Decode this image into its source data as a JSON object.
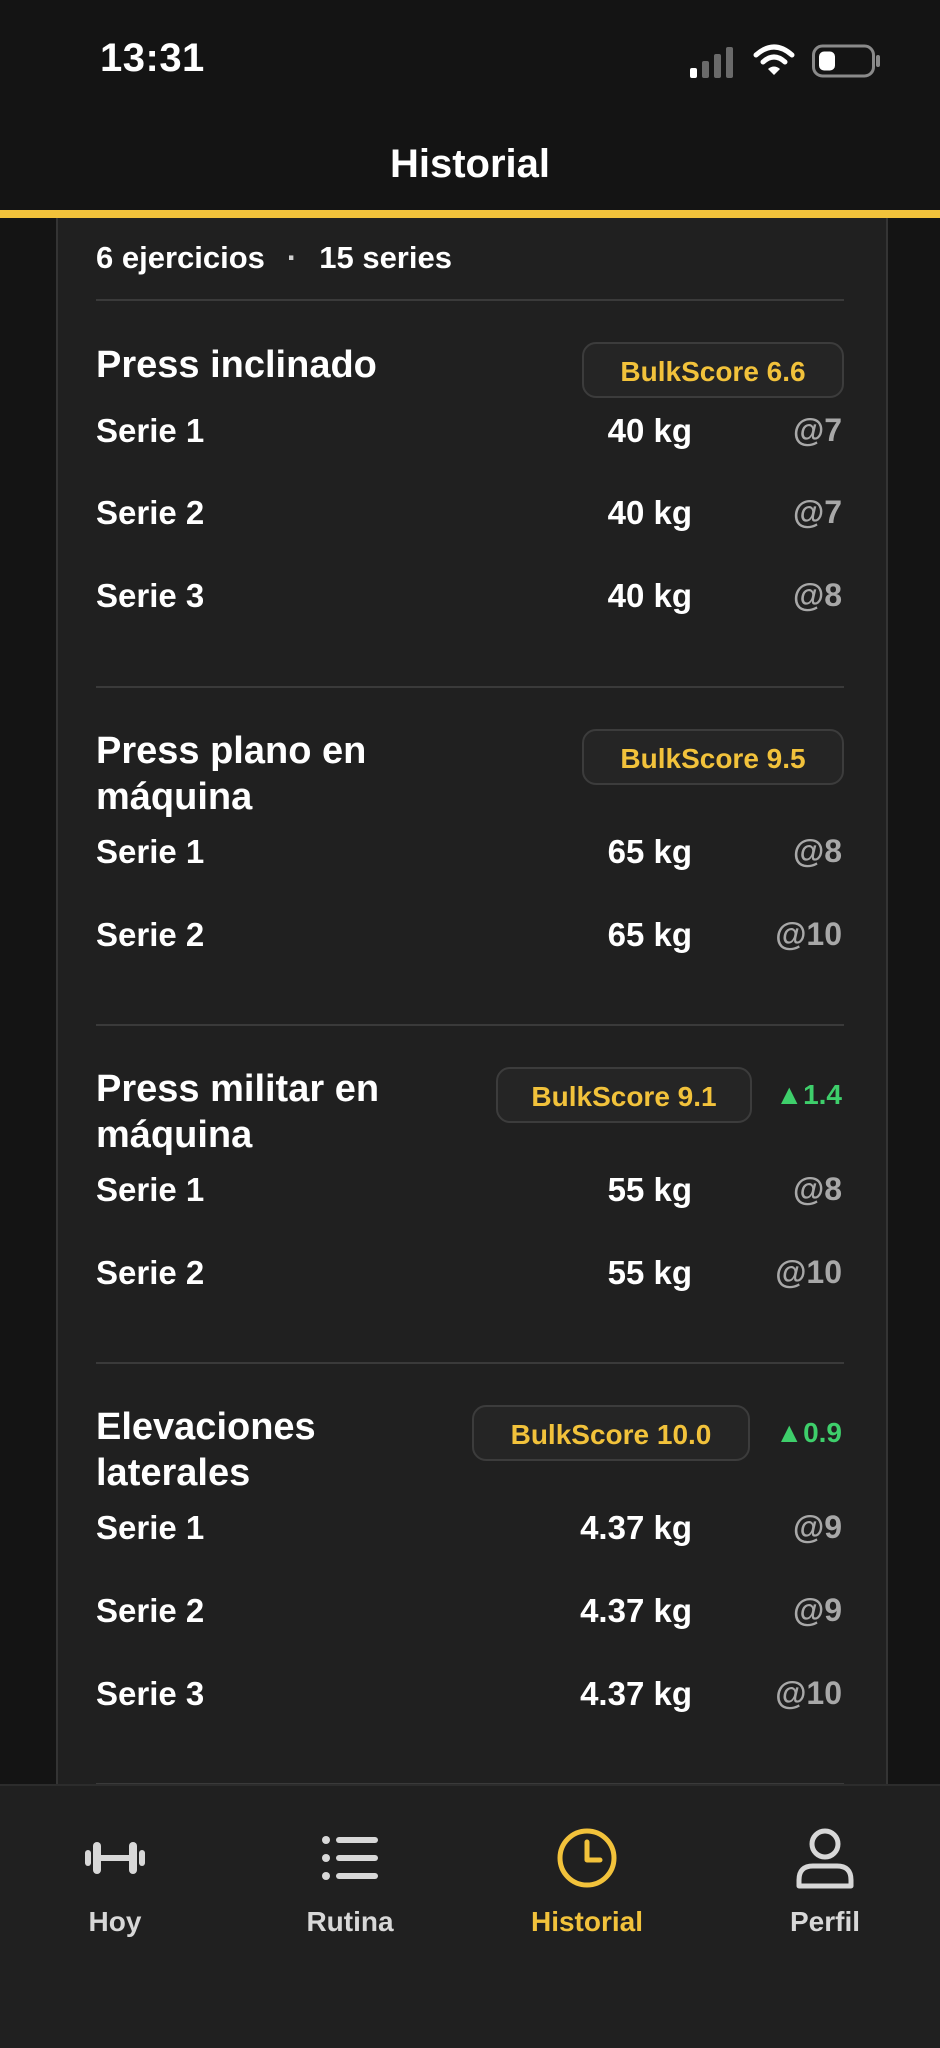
{
  "status_bar": {
    "time": "13:31"
  },
  "header": {
    "title": "Historial"
  },
  "summary": {
    "exercises": "6 ejercicios",
    "separator": "·",
    "series": "15 series"
  },
  "exercises": [
    {
      "name": "Press inclinado",
      "score": "BulkScore 6.6",
      "delta": "",
      "sets": [
        {
          "label": "Serie 1",
          "weight": "40 kg",
          "rpe": "@7"
        },
        {
          "label": "Serie 2",
          "weight": "40 kg",
          "rpe": "@7"
        },
        {
          "label": "Serie 3",
          "weight": "40 kg",
          "rpe": "@8"
        }
      ]
    },
    {
      "name": "Press plano en máquina",
      "score": "BulkScore 9.5",
      "delta": "",
      "sets": [
        {
          "label": "Serie 1",
          "weight": "65 kg",
          "rpe": "@8"
        },
        {
          "label": "Serie 2",
          "weight": "65 kg",
          "rpe": "@10"
        }
      ]
    },
    {
      "name": "Press militar en máquina",
      "score": "BulkScore 9.1",
      "delta": "▲1.4",
      "sets": [
        {
          "label": "Serie 1",
          "weight": "55 kg",
          "rpe": "@8"
        },
        {
          "label": "Serie 2",
          "weight": "55 kg",
          "rpe": "@10"
        }
      ]
    },
    {
      "name": "Elevaciones laterales",
      "score": "BulkScore 10.0",
      "delta": "▲0.9",
      "sets": [
        {
          "label": "Serie 1",
          "weight": "4.37 kg",
          "rpe": "@9"
        },
        {
          "label": "Serie 2",
          "weight": "4.37 kg",
          "rpe": "@9"
        },
        {
          "label": "Serie 3",
          "weight": "4.37 kg",
          "rpe": "@10"
        }
      ]
    }
  ],
  "tabs": [
    {
      "label": "Hoy",
      "icon": "dumbbell-icon",
      "active": false
    },
    {
      "label": "Rutina",
      "icon": "list-icon",
      "active": false
    },
    {
      "label": "Historial",
      "icon": "clock-icon",
      "active": true
    },
    {
      "label": "Perfil",
      "icon": "person-icon",
      "active": false
    }
  ],
  "colors": {
    "accent": "#f2c23b",
    "positive": "#3ecf6b",
    "background": "#141414",
    "card": "#202020"
  }
}
